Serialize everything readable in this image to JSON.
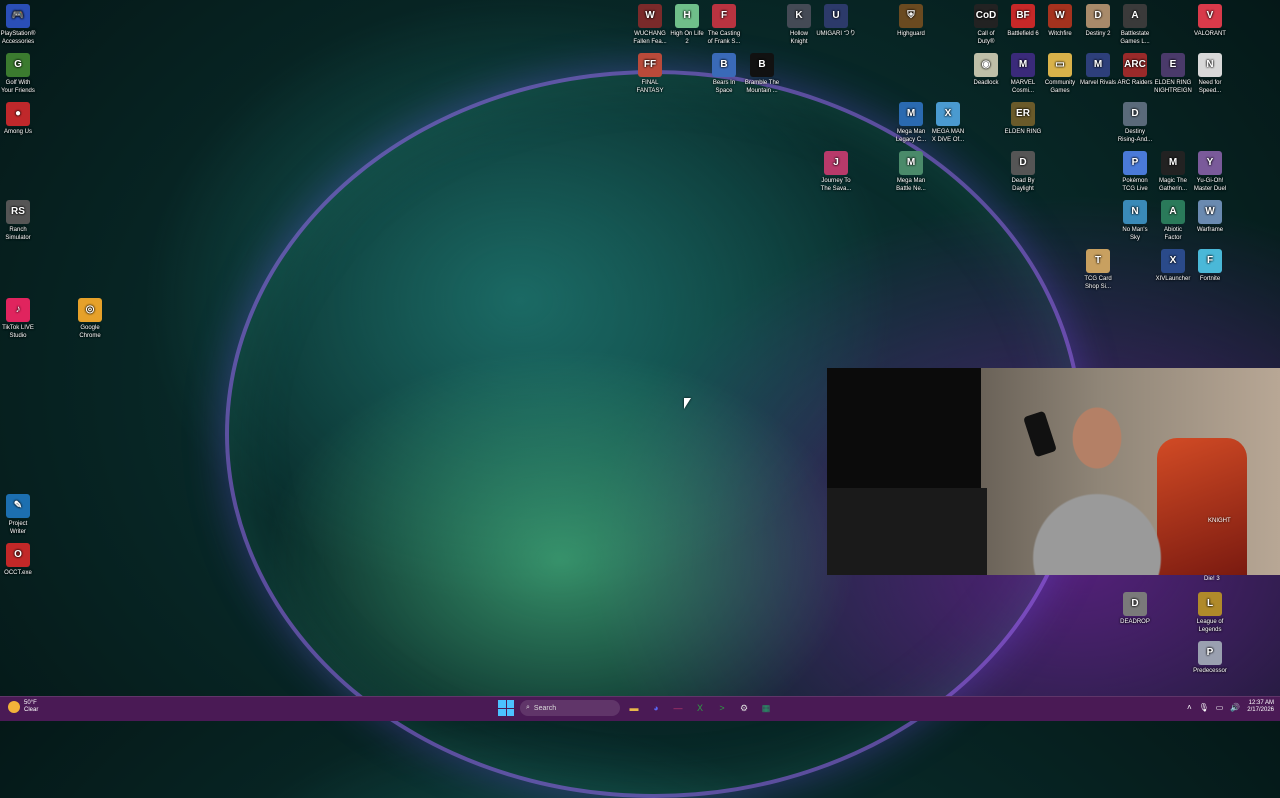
{
  "desktop": {
    "icons": [
      {
        "label": "PlayStation®\nAccessories",
        "icon": "playstation-icon",
        "color": "#2a4fb8",
        "glyph": "🎮"
      },
      {
        "label": "Golf With\nYour Friends",
        "icon": "golf-icon",
        "color": "#3b7b2f",
        "glyph": "G"
      },
      {
        "label": "Among Us",
        "icon": "among-us-icon",
        "color": "#c0282b",
        "glyph": "●"
      },
      {
        "label": "Ranch\nSimulator",
        "icon": "ranch-icon",
        "color": "#555555",
        "glyph": "RS"
      },
      {
        "label": "TikTok LIVE\nStudio",
        "icon": "tiktok-icon",
        "color": "#e0245e",
        "glyph": "♪"
      },
      {
        "label": "Google\nChrome",
        "icon": "chrome-icon",
        "color": "#e6a12a",
        "glyph": "◎"
      },
      {
        "label": "Project\nWriter",
        "icon": "project-writer-icon",
        "color": "#1c6fb0",
        "glyph": "✎"
      },
      {
        "label": "OCCT.exe",
        "icon": "occt-icon",
        "color": "#c22828",
        "glyph": "O"
      },
      {
        "label": "WUCHANG\nFallen Fea...",
        "icon": "wuchang-icon",
        "color": "#7a2a2a",
        "glyph": "W"
      },
      {
        "label": "High On Life\n2",
        "icon": "high-on-life-icon",
        "color": "#6fbf8a",
        "glyph": "H"
      },
      {
        "label": "The Casting\nof Frank S...",
        "icon": "frank-icon",
        "color": "#b93340",
        "glyph": "F"
      },
      {
        "label": "Hollow\nKnight",
        "icon": "hollow-knight-icon",
        "color": "#444a55",
        "glyph": "K"
      },
      {
        "label": "UMIGARI つり",
        "icon": "umigari-icon",
        "color": "#2c3a6a",
        "glyph": "U"
      },
      {
        "label": "Highguard",
        "icon": "highguard-icon",
        "color": "#6a4a20",
        "glyph": "⛨"
      },
      {
        "label": "Call of\nDuty®",
        "icon": "call-of-duty-icon",
        "color": "#222222",
        "glyph": "CoD"
      },
      {
        "label": "Battlefield 6",
        "icon": "battlefield-icon",
        "color": "#c62828",
        "glyph": "BF"
      },
      {
        "label": "Witchfire",
        "icon": "witchfire-icon",
        "color": "#a5321e",
        "glyph": "W"
      },
      {
        "label": "Destiny 2",
        "icon": "destiny-icon",
        "color": "#a88a6a",
        "glyph": "D"
      },
      {
        "label": "Battlestate\nGames L...",
        "icon": "battlestate-icon",
        "color": "#3a3a3a",
        "glyph": "A"
      },
      {
        "label": "VALORANT",
        "icon": "valorant-icon",
        "color": "#d83a4a",
        "glyph": "V"
      },
      {
        "label": "FINAL\nFANTASY",
        "icon": "final-fantasy-icon",
        "color": "#b94a3a",
        "glyph": "FF"
      },
      {
        "label": "Bears In\nSpace",
        "icon": "bears-in-space-icon",
        "color": "#3a6ab8",
        "glyph": "B"
      },
      {
        "label": "Bramble The\nMountain ...",
        "icon": "bramble-icon",
        "color": "#111111",
        "glyph": "B"
      },
      {
        "label": "Deadlock",
        "icon": "deadlock-icon",
        "color": "#bfbfa8",
        "glyph": "◉"
      },
      {
        "label": "MARVEL\nCosmi...",
        "icon": "marvel-cosmic-icon",
        "color": "#3a2a7a",
        "glyph": "M"
      },
      {
        "label": "Community\nGames",
        "icon": "folder-icon",
        "color": "#d9b24a",
        "glyph": "▭"
      },
      {
        "label": "Marvel Rivals",
        "icon": "marvel-rivals-icon",
        "color": "#2d3f7a",
        "glyph": "M"
      },
      {
        "label": "ARC Raiders",
        "icon": "arc-raiders-icon",
        "color": "#9a2a2a",
        "glyph": "ARC"
      },
      {
        "label": "ELDEN RING\nNIGHTREIGN",
        "icon": "nightreign-icon",
        "color": "#4a3a6a",
        "glyph": "E"
      },
      {
        "label": "Need for\nSpeed...",
        "icon": "nfs-icon",
        "color": "#d8d8d8",
        "glyph": "N"
      },
      {
        "label": "Mega Man\nLegacy C...",
        "icon": "megaman-legacy-icon",
        "color": "#2a6ab0",
        "glyph": "M"
      },
      {
        "label": "MEGA MAN\nX DiVE Of...",
        "icon": "megaman-x-icon",
        "color": "#4a9ad0",
        "glyph": "X"
      },
      {
        "label": "ELDEN RING",
        "icon": "elden-ring-icon",
        "color": "#6a5a2a",
        "glyph": "ER"
      },
      {
        "label": "Destiny\nRising-And...",
        "icon": "destiny-rising-icon",
        "color": "#5a6a7a",
        "glyph": "D"
      },
      {
        "label": "Journey To\nThe Sava...",
        "icon": "journey-icon",
        "color": "#b83a6a",
        "glyph": "J"
      },
      {
        "label": "Mega Man\nBattle Ne...",
        "icon": "megaman-bn-icon",
        "color": "#4a8a6a",
        "glyph": "M"
      },
      {
        "label": "Dead By\nDaylight",
        "icon": "dbd-icon",
        "color": "#555555",
        "glyph": "D"
      },
      {
        "label": "Pokémon\nTCG Live",
        "icon": "pokemon-icon",
        "color": "#4a7ad8",
        "glyph": "P"
      },
      {
        "label": "Magic The\nGatherin...",
        "icon": "magic-icon",
        "color": "#222222",
        "glyph": "M"
      },
      {
        "label": "Yu-Gi-Oh!\nMaster Duel",
        "icon": "yugioh-icon",
        "color": "#7a5a9a",
        "glyph": "Y"
      },
      {
        "label": "No Man's\nSky",
        "icon": "no-mans-sky-icon",
        "color": "#3a8ab8",
        "glyph": "N"
      },
      {
        "label": "Abiotic\nFactor",
        "icon": "abiotic-icon",
        "color": "#2a7a5a",
        "glyph": "A"
      },
      {
        "label": "Warframe",
        "icon": "warframe-icon",
        "color": "#6a8ab0",
        "glyph": "W"
      },
      {
        "label": "TCG Card\nShop Si...",
        "icon": "tcg-shop-icon",
        "color": "#c8a060",
        "glyph": "T"
      },
      {
        "label": "XIVLauncher",
        "icon": "xivlauncher-icon",
        "color": "#2a4a8a",
        "glyph": "X"
      },
      {
        "label": "Fortnite",
        "icon": "fortnite-icon",
        "color": "#4ab8d8",
        "glyph": "F"
      },
      {
        "label": "DEADROP",
        "icon": "deadrop-icon",
        "color": "#7a7a7a",
        "glyph": "D"
      },
      {
        "label": "League of\nLegends",
        "icon": "lol-icon",
        "color": "#b08a2a",
        "glyph": "L"
      },
      {
        "label": "Predecessor",
        "icon": "predecessor-icon",
        "color": "#9aa0b0",
        "glyph": "P"
      }
    ],
    "partial_labels": {
      "knight": "KNIGHT",
      "die": "Die! 3"
    }
  },
  "taskbar": {
    "weather_temp": "50°F",
    "weather_desc": "Clear",
    "search_placeholder": "Search",
    "apps": [
      {
        "name": "file-explorer-icon",
        "glyph": "▬",
        "color": "#e8b84a"
      },
      {
        "name": "discord-icon",
        "glyph": "◕",
        "color": "#5865f2"
      },
      {
        "name": "obs-icon",
        "glyph": "—",
        "color": "#c03a6a"
      },
      {
        "name": "xbox-icon",
        "glyph": "X",
        "color": "#2ea043"
      },
      {
        "name": "terminal-icon",
        "glyph": ">",
        "color": "#2ea043"
      },
      {
        "name": "settings-gear-icon",
        "glyph": "⚙",
        "color": "#dddddd"
      },
      {
        "name": "spreadsheet-icon",
        "glyph": "▦",
        "color": "#21a366"
      }
    ],
    "time": "12:37 AM",
    "date": "2/17/2026"
  }
}
